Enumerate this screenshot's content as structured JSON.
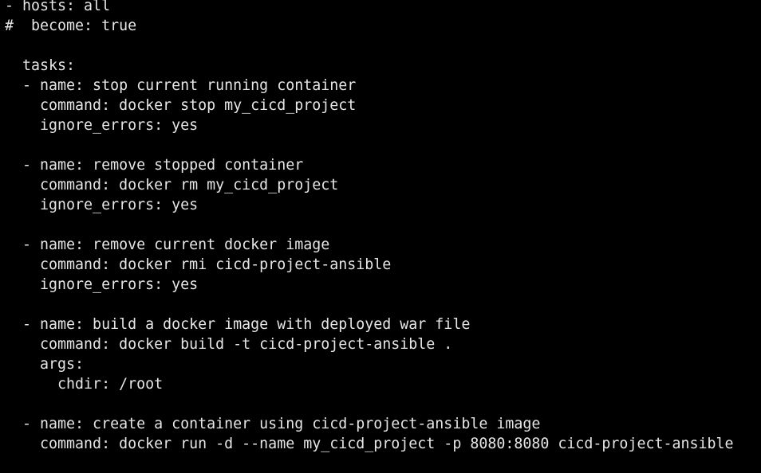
{
  "terminal": {
    "lines": [
      "- hosts: all",
      "#  become: true",
      "",
      "  tasks:",
      "  - name: stop current running container",
      "    command: docker stop my_cicd_project",
      "    ignore_errors: yes",
      "",
      "  - name: remove stopped container",
      "    command: docker rm my_cicd_project",
      "    ignore_errors: yes",
      "",
      "  - name: remove current docker image",
      "    command: docker rmi cicd-project-ansible",
      "    ignore_errors: yes",
      "",
      "  - name: build a docker image with deployed war file",
      "    command: docker build -t cicd-project-ansible .",
      "    args:",
      "      chdir: /root",
      "",
      "  - name: create a container using cicd-project-ansible image",
      "    command: docker run -d --name my_cicd_project -p 8080:8080 cicd-project-ansible"
    ],
    "colors": {
      "background": "#000000",
      "text": "#e6e6e6"
    }
  }
}
